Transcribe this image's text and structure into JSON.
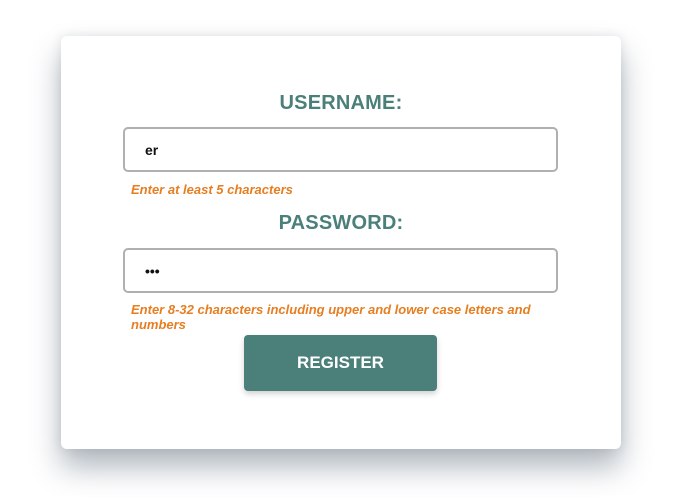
{
  "form": {
    "username_label": "USERNAME:",
    "username_value": "er",
    "username_hint": "Enter at least 5 characters",
    "password_label": "PASSWORD:",
    "password_value": "***",
    "password_hint": "Enter 8-32 characters including upper and lower case letters and numbers",
    "register_label": "REGISTER"
  },
  "colors": {
    "accent": "#4a7f7a",
    "hint": "#e67e22"
  }
}
